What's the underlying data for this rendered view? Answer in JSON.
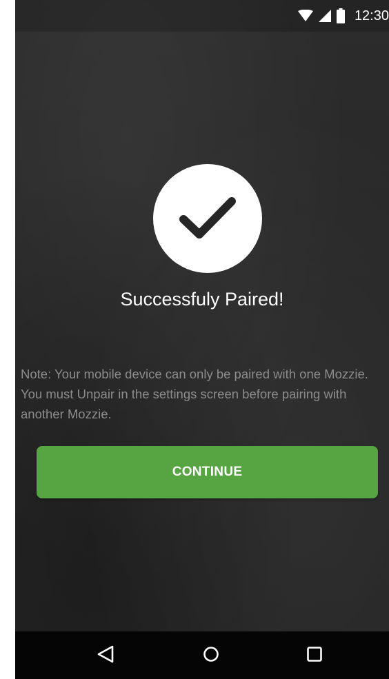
{
  "status_bar": {
    "time": "12:30",
    "icons": [
      "wifi-icon",
      "cell-signal-icon",
      "battery-icon"
    ]
  },
  "pairing": {
    "icon": "checkmark-icon",
    "title": "Successfuly Paired!",
    "note": "Note: Your mobile device can only be paired with one Mozzie. You must Unpair in the settings screen before pairing with another Mozzie.",
    "continue_label": "CONTINUE"
  },
  "nav_bar": {
    "icons": [
      "back-icon",
      "home-icon",
      "recent-apps-icon"
    ]
  },
  "colors": {
    "background": "#282828",
    "accent": "#57a442",
    "note_text": "#8c8c8c",
    "nav_bar": "#050505"
  }
}
